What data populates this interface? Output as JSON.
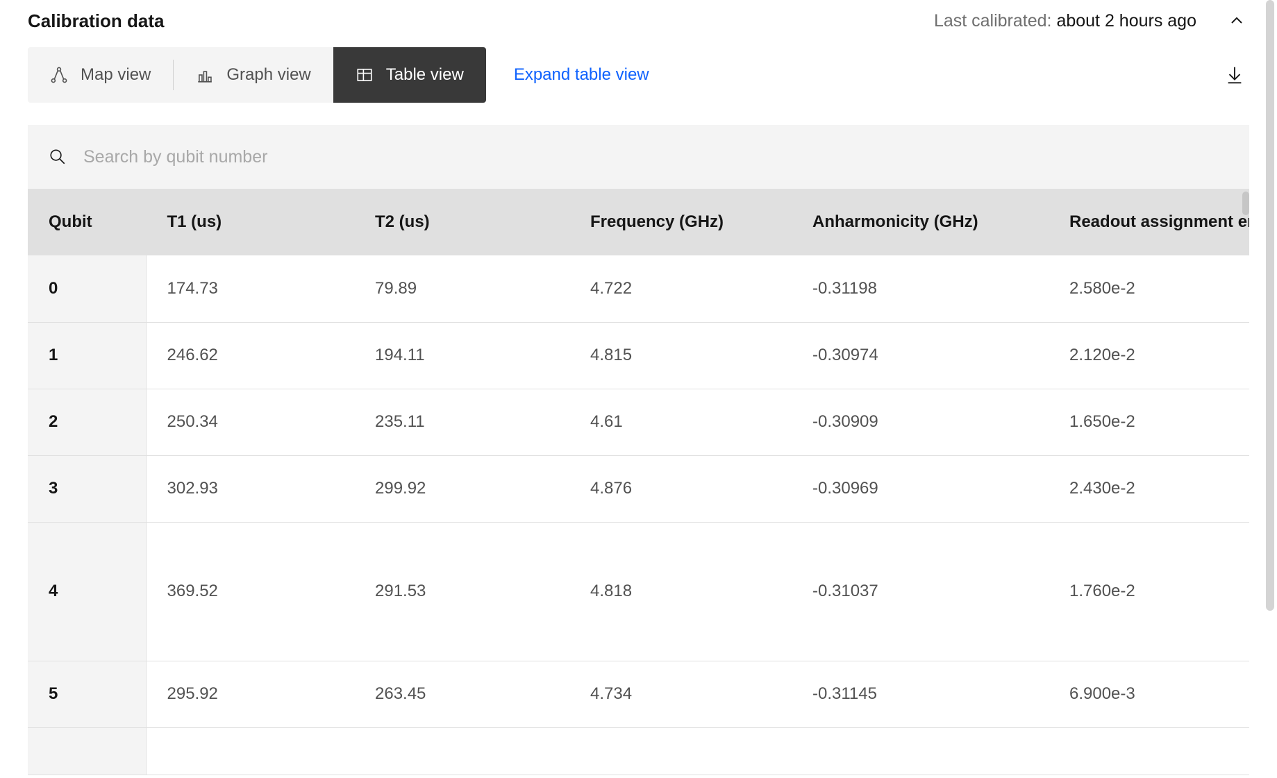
{
  "header": {
    "title": "Calibration data",
    "last_calibrated_label": "Last calibrated: ",
    "last_calibrated_value": "about 2 hours ago"
  },
  "tabs": {
    "map": "Map view",
    "graph": "Graph view",
    "table": "Table view"
  },
  "expand_link": "Expand table view",
  "search": {
    "placeholder": "Search by qubit number"
  },
  "table": {
    "columns": [
      "Qubit",
      "T1 (us)",
      "T2 (us)",
      "Frequency (GHz)",
      "Anharmonicity (GHz)",
      "Readout assignment error"
    ],
    "rows": [
      {
        "qubit": "0",
        "t1": "174.73",
        "t2": "79.89",
        "freq": "4.722",
        "anh": "-0.31198",
        "ro": "2.580e-2"
      },
      {
        "qubit": "1",
        "t1": "246.62",
        "t2": "194.11",
        "freq": "4.815",
        "anh": "-0.30974",
        "ro": "2.120e-2"
      },
      {
        "qubit": "2",
        "t1": "250.34",
        "t2": "235.11",
        "freq": "4.61",
        "anh": "-0.30909",
        "ro": "1.650e-2"
      },
      {
        "qubit": "3",
        "t1": "302.93",
        "t2": "299.92",
        "freq": "4.876",
        "anh": "-0.30969",
        "ro": "2.430e-2"
      },
      {
        "qubit": "4",
        "t1": "369.52",
        "t2": "291.53",
        "freq": "4.818",
        "anh": "-0.31037",
        "ro": "1.760e-2"
      },
      {
        "qubit": "5",
        "t1": "295.92",
        "t2": "263.45",
        "freq": "4.734",
        "anh": "-0.31145",
        "ro": "6.900e-3"
      }
    ]
  }
}
